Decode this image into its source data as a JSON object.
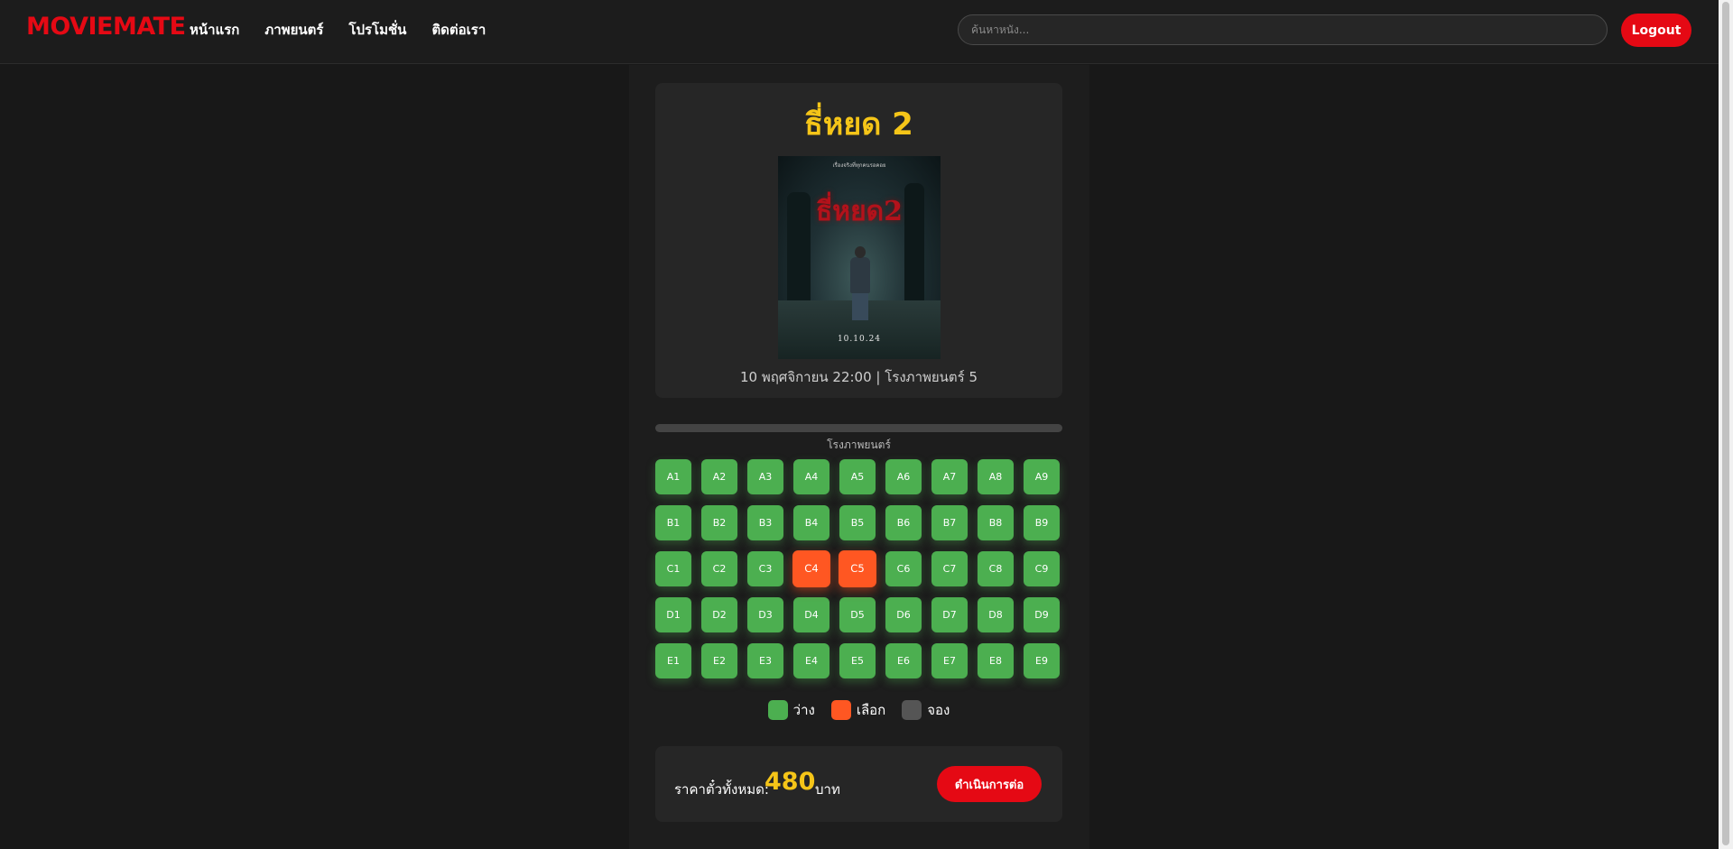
{
  "header": {
    "logo": "MOVIEMATE",
    "nav": [
      "หน้าแรก",
      "ภาพยนตร์",
      "โปรโมชั่น",
      "ติดต่อเรา"
    ],
    "search_placeholder": "ค้นหาหนัง...",
    "logout_label": "Logout"
  },
  "movie": {
    "title": "ธี่หยด 2",
    "poster": {
      "title": "ธี่หยด2",
      "tagline": "เรื่องจริงที่ทุกคนรอคอย",
      "date": "10.10.24"
    },
    "info": "10 พฤศจิกายน 22:00 | โรงภาพยนตร์ 5"
  },
  "screen_label": "โรงภาพยนตร์",
  "seats": {
    "rows": [
      [
        "A1",
        "A2",
        "A3",
        "A4",
        "A5",
        "A6",
        "A7",
        "A8",
        "A9"
      ],
      [
        "B1",
        "B2",
        "B3",
        "B4",
        "B5",
        "B6",
        "B7",
        "B8",
        "B9"
      ],
      [
        "C1",
        "C2",
        "C3",
        "C4",
        "C5",
        "C6",
        "C7",
        "C8",
        "C9"
      ],
      [
        "D1",
        "D2",
        "D3",
        "D4",
        "D5",
        "D6",
        "D7",
        "D8",
        "D9"
      ],
      [
        "E1",
        "E2",
        "E3",
        "E4",
        "E5",
        "E6",
        "E7",
        "E8",
        "E9"
      ]
    ],
    "selected": [
      "C4",
      "C5"
    ],
    "booked": []
  },
  "legend": {
    "available": "ว่าง",
    "selected": "เลือก",
    "booked": "จอง"
  },
  "colors": {
    "available": "#4caf50",
    "selected": "#ff5722",
    "booked": "#555555",
    "brand": "#e50914",
    "accent": "#f5c518"
  },
  "total": {
    "label": "ราคาตั๋วทั้งหมด:",
    "amount": "480",
    "currency": "บาท",
    "continue_label": "ดำเนินการต่อ"
  }
}
